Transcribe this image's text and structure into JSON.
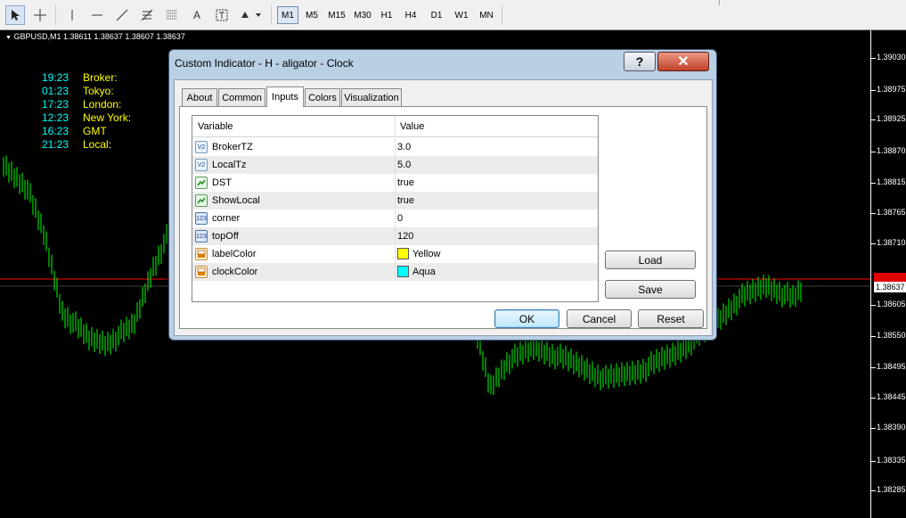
{
  "toolbar": {
    "timeframes": [
      "M1",
      "M5",
      "M15",
      "M30",
      "H1",
      "H4",
      "D1",
      "W1",
      "MN"
    ],
    "active_timeframe": "M1",
    "tools": [
      "cursor-icon",
      "crosshair-icon",
      "vertical-line-icon",
      "horizontal-line-icon",
      "trendline-icon",
      "fibonacci-icon",
      "fibonacci-grid-icon",
      "text-icon",
      "text-label-icon",
      "arrows-icon"
    ],
    "text_tool_label": "A"
  },
  "chart": {
    "symbol_line": "GBPUSD,M1  1.38611 1.38637 1.38607 1.38637",
    "clock": [
      {
        "time": "19:23",
        "label": "Broker:"
      },
      {
        "time": "01:23",
        "label": "Tokyo:"
      },
      {
        "time": "17:23",
        "label": "London:"
      },
      {
        "time": "12:23",
        "label": "New York:"
      },
      {
        "time": "16:23",
        "label": "GMT"
      },
      {
        "time": "21:23",
        "label": "Local:"
      }
    ],
    "price_labels": [
      "1.39030",
      "1.38975",
      "1.38925",
      "1.38870",
      "1.38815",
      "1.38765",
      "1.38710",
      "1.38605",
      "1.38550",
      "1.38495",
      "1.38445",
      "1.38390",
      "1.38335",
      "1.38285"
    ],
    "current_price": "1.38637",
    "colors": {
      "background": "#000000",
      "candles": "#00ff00",
      "price_line": "#ff0000",
      "clock_time": "#00ffff",
      "clock_label": "#ffff00"
    }
  },
  "dialog": {
    "title": "Custom Indicator - H - aligator - Clock",
    "help_label": "?",
    "close_label": "✕",
    "tabs": [
      "About",
      "Common",
      "Inputs",
      "Colors",
      "Visualization"
    ],
    "active_tab": "Inputs",
    "table": {
      "headers": {
        "variable": "Variable",
        "value": "Value"
      },
      "rows": [
        {
          "icon": "V2",
          "type": "double",
          "name": "BrokerTZ",
          "value": "3.0"
        },
        {
          "icon": "V2",
          "type": "double",
          "name": "LocalTz",
          "value": "5.0"
        },
        {
          "icon": "bool",
          "type": "bool",
          "name": "DST",
          "value": "true"
        },
        {
          "icon": "bool",
          "type": "bool",
          "name": "ShowLocal",
          "value": "true"
        },
        {
          "icon": "123",
          "type": "int",
          "name": "corner",
          "value": "0"
        },
        {
          "icon": "123",
          "type": "int",
          "name": "topOff",
          "value": "120"
        },
        {
          "icon": "color",
          "type": "color",
          "name": "labelColor",
          "value": "Yellow",
          "swatch": "#ffff00"
        },
        {
          "icon": "color",
          "type": "color",
          "name": "clockColor",
          "value": "Aqua",
          "swatch": "#00ffff"
        }
      ]
    },
    "buttons": {
      "load": "Load",
      "save": "Save",
      "ok": "OK",
      "cancel": "Cancel",
      "reset": "Reset"
    }
  }
}
